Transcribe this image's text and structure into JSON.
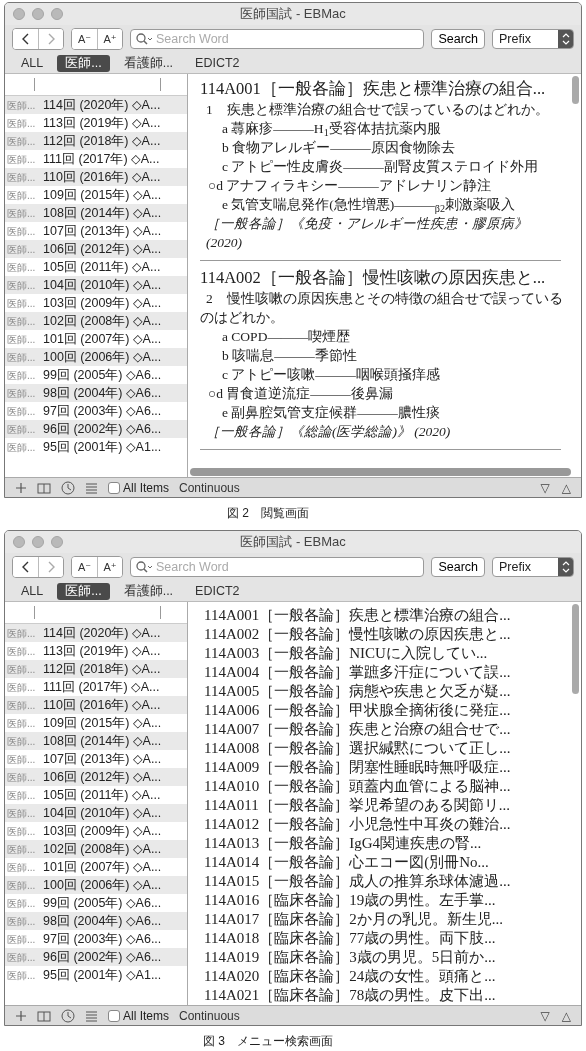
{
  "figures": [
    {
      "window": {
        "title": "医師国試 - EBMac"
      },
      "toolbar": {
        "back": {
          "disabled": false
        },
        "forward": {
          "disabled": true
        },
        "font_smaller": "A⁻",
        "font_larger": "A⁺",
        "search": {
          "placeholder": "Search Word"
        },
        "search_button": "Search",
        "mode": "Prefix"
      },
      "tabs": [
        {
          "label": "ALL",
          "selected": false
        },
        {
          "label": "医師...",
          "selected": true
        },
        {
          "label": "看護師...",
          "selected": false
        },
        {
          "label": "EDICT2",
          "selected": false
        }
      ],
      "sidebar": {
        "rows": [
          {
            "source": "医師...",
            "label": "114回 (2020年) ◇A..."
          },
          {
            "source": "医師...",
            "label": "113回 (2019年) ◇A..."
          },
          {
            "source": "医師...",
            "label": "112回 (2018年) ◇A..."
          },
          {
            "source": "医師...",
            "label": "111回 (2017年) ◇A..."
          },
          {
            "source": "医師...",
            "label": "110回 (2016年) ◇A..."
          },
          {
            "source": "医師...",
            "label": "109回 (2015年) ◇A..."
          },
          {
            "source": "医師...",
            "label": "108回 (2014年) ◇A..."
          },
          {
            "source": "医師...",
            "label": "107回 (2013年) ◇A..."
          },
          {
            "source": "医師...",
            "label": "106回 (2012年) ◇A..."
          },
          {
            "source": "医師...",
            "label": "105回 (2011年) ◇A..."
          },
          {
            "source": "医師...",
            "label": "104回 (2010年) ◇A..."
          },
          {
            "source": "医師...",
            "label": "103回 (2009年) ◇A..."
          },
          {
            "source": "医師...",
            "label": "102回 (2008年) ◇A..."
          },
          {
            "source": "医師...",
            "label": "101回 (2007年) ◇A..."
          },
          {
            "source": "医師...",
            "label": "100回 (2006年) ◇A..."
          },
          {
            "source": "医師...",
            "label": "99回 (2005年) ◇A6..."
          },
          {
            "source": "医師...",
            "label": "98回 (2004年) ◇A6..."
          },
          {
            "source": "医師...",
            "label": "97回 (2003年) ◇A6..."
          },
          {
            "source": "医師...",
            "label": "96回 (2002年) ◇A6..."
          },
          {
            "source": "医師...",
            "label": "95回 (2001年) ◇A1..."
          }
        ]
      },
      "content": {
        "kind": "entries",
        "entries": [
          {
            "heading": "114A001［一般各論］疾患と標準治療の組合...",
            "question": "1　疾患と標準治療の組合せで誤っているのはどれか。",
            "choices": [
              {
                "text": "a 蕁麻疹―――H$_{1}$受容体拮抗薬内服",
                "correct": false
              },
              {
                "text": "b 食物アレルギー―――原因食物除去",
                "correct": false
              },
              {
                "text": "c アトピー性皮膚炎―――副腎皮質ステロイド外用",
                "correct": false
              },
              {
                "text": "○d アナフィラキシー―――アドレナリン静注",
                "correct": true
              },
              {
                "text": "e 気管支喘息発作(急性増悪)―――$_{β2}$刺激薬吸入",
                "correct": false
              }
            ],
            "footer": "［一般各論］《免疫・アレルギー性疾患・膠原病》 (2020)"
          },
          {
            "heading": "114A002［一般各論］慢性咳嗽の原因疾患と...",
            "question": "2　慢性咳嗽の原因疾患とその特徴の組合せで誤っているのはどれか。",
            "choices": [
              {
                "text": "a COPD―――喫煙歴",
                "correct": false
              },
              {
                "text": "b 咳喘息―――季節性",
                "correct": false
              },
              {
                "text": "c アトピー咳嗽―――咽喉頭掻痒感",
                "correct": false
              },
              {
                "text": "○d 胃食道逆流症―――後鼻漏",
                "correct": true
              },
              {
                "text": "e 副鼻腔気管支症候群―――膿性痰",
                "correct": false
              }
            ],
            "footer": "［一般各論］《総論(医学総論)》 (2020)"
          }
        ]
      },
      "bottom_bar": {
        "all_items": {
          "label": "All Items",
          "checked": false
        },
        "view_mode": "Continuous",
        "prev": "▽",
        "next": "△"
      },
      "caption": "図 2　閲覧画面"
    },
    {
      "window": {
        "title": "医師国試 - EBMac"
      },
      "toolbar": {
        "back": {
          "disabled": false
        },
        "forward": {
          "disabled": true
        },
        "font_smaller": "A⁻",
        "font_larger": "A⁺",
        "search": {
          "placeholder": "Search Word"
        },
        "search_button": "Search",
        "mode": "Prefix"
      },
      "tabs": [
        {
          "label": "ALL",
          "selected": false
        },
        {
          "label": "医師...",
          "selected": true
        },
        {
          "label": "看護師...",
          "selected": false
        },
        {
          "label": "EDICT2",
          "selected": false
        }
      ],
      "sidebar": {
        "rows": [
          {
            "source": "医師...",
            "label": "114回 (2020年) ◇A..."
          },
          {
            "source": "医師...",
            "label": "113回 (2019年) ◇A..."
          },
          {
            "source": "医師...",
            "label": "112回 (2018年) ◇A..."
          },
          {
            "source": "医師...",
            "label": "111回 (2017年) ◇A..."
          },
          {
            "source": "医師...",
            "label": "110回 (2016年) ◇A..."
          },
          {
            "source": "医師...",
            "label": "109回 (2015年) ◇A..."
          },
          {
            "source": "医師...",
            "label": "108回 (2014年) ◇A..."
          },
          {
            "source": "医師...",
            "label": "107回 (2013年) ◇A..."
          },
          {
            "source": "医師...",
            "label": "106回 (2012年) ◇A..."
          },
          {
            "source": "医師...",
            "label": "105回 (2011年) ◇A..."
          },
          {
            "source": "医師...",
            "label": "104回 (2010年) ◇A..."
          },
          {
            "source": "医師...",
            "label": "103回 (2009年) ◇A..."
          },
          {
            "source": "医師...",
            "label": "102回 (2008年) ◇A..."
          },
          {
            "source": "医師...",
            "label": "101回 (2007年) ◇A..."
          },
          {
            "source": "医師...",
            "label": "100回 (2006年) ◇A..."
          },
          {
            "source": "医師...",
            "label": "99回 (2005年) ◇A6..."
          },
          {
            "source": "医師...",
            "label": "98回 (2004年) ◇A6..."
          },
          {
            "source": "医師...",
            "label": "97回 (2003年) ◇A6..."
          },
          {
            "source": "医師...",
            "label": "96回 (2002年) ◇A6..."
          },
          {
            "source": "医師...",
            "label": "95回 (2001年) ◇A1..."
          }
        ]
      },
      "content": {
        "kind": "results",
        "items": [
          "114A001［一般各論］疾患と標準治療の組合...",
          "114A002［一般各論］慢性咳嗽の原因疾患と...",
          "114A003［一般各論］NICUに入院してい...",
          "114A004［一般各論］掌蹠多汗症について誤...",
          "114A005［一般各論］病態や疾患と欠乏が疑...",
          "114A006［一般各論］甲状腺全摘術後に発症...",
          "114A007［一般各論］疾患と治療の組合せで...",
          "114A008［一般各論］選択緘黙について正し...",
          "114A009［一般各論］閉塞性睡眠時無呼吸症...",
          "114A010［一般各論］頭蓋内血管による脳神...",
          "114A011［一般各論］挙児希望のある関節リ...",
          "114A012［一般各論］小児急性中耳炎の難治...",
          "114A013［一般各論］IgG4関連疾患の腎...",
          "114A014［一般各論］心エコー図(別冊No...",
          "114A015［一般各論］成人の推算糸球体濾過...",
          "114A016［臨床各論］19歳の男性。左手掌...",
          "114A017［臨床各論］2か月の乳児。新生児...",
          "114A018［臨床各論］77歳の男性。両下肢...",
          "114A019［臨床各論］3歳の男児。5日前か...",
          "114A020［臨床各論］24歳の女性。頭痛と...",
          "114A021［臨床各論］78歳の男性。皮下出..."
        ]
      },
      "bottom_bar": {
        "all_items": {
          "label": "All Items",
          "checked": false
        },
        "view_mode": "Continuous",
        "prev": "▽",
        "next": "△"
      },
      "caption": "図 3　メニュー検索画面"
    }
  ]
}
